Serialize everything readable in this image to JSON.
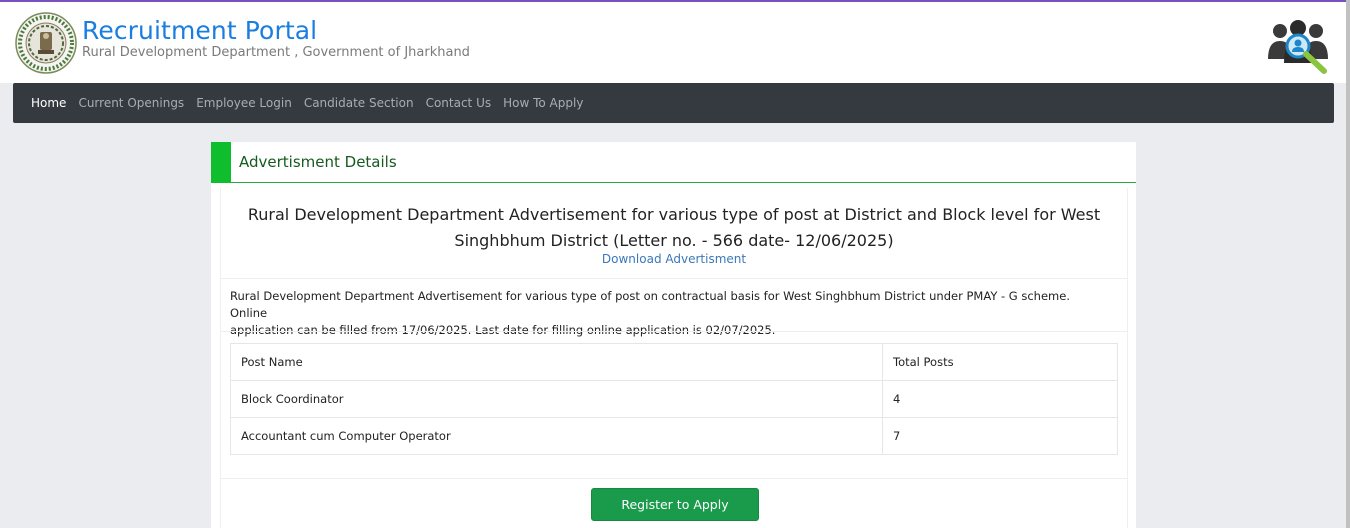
{
  "header": {
    "title": "Recruitment Portal",
    "subtitle": "Rural Development Department , Government of Jharkhand",
    "logo_icon": "jharkhand-emblem-icon",
    "right_icon": "people-search-icon"
  },
  "nav": {
    "items": [
      {
        "label": "Home",
        "active": true
      },
      {
        "label": "Current Openings"
      },
      {
        "label": "Employee Login"
      },
      {
        "label": "Candidate Section"
      },
      {
        "label": "Contact Us"
      },
      {
        "label": "How To Apply"
      }
    ]
  },
  "card": {
    "title": "Advertisment Details",
    "heading_line1": "Rural Development Department Advertisement for various type of post at District and Block level for West",
    "heading_line2": "Singhbhum District (Letter no. - 566 date- 12/06/2025)",
    "download_label": "Download Advertisment",
    "description_line1": "Rural Development Department Advertisement for various type of post on contractual basis for West Singhbhum District under PMAY - G scheme. Online",
    "description_line2": "application can be filled from 17/06/2025. Last date for filling online application is 02/07/2025.",
    "table": {
      "headers": [
        "Post Name",
        "Total Posts"
      ],
      "rows": [
        [
          "Block Coordinator",
          "4"
        ],
        [
          "Accountant cum Computer Operator",
          "7"
        ]
      ]
    },
    "register_label": "Register to Apply"
  },
  "colors": {
    "accent_green": "#0fbe2c",
    "title_blue": "#1a7ee0",
    "nav_bg": "#343a40",
    "button_green": "#1a9b4b"
  }
}
